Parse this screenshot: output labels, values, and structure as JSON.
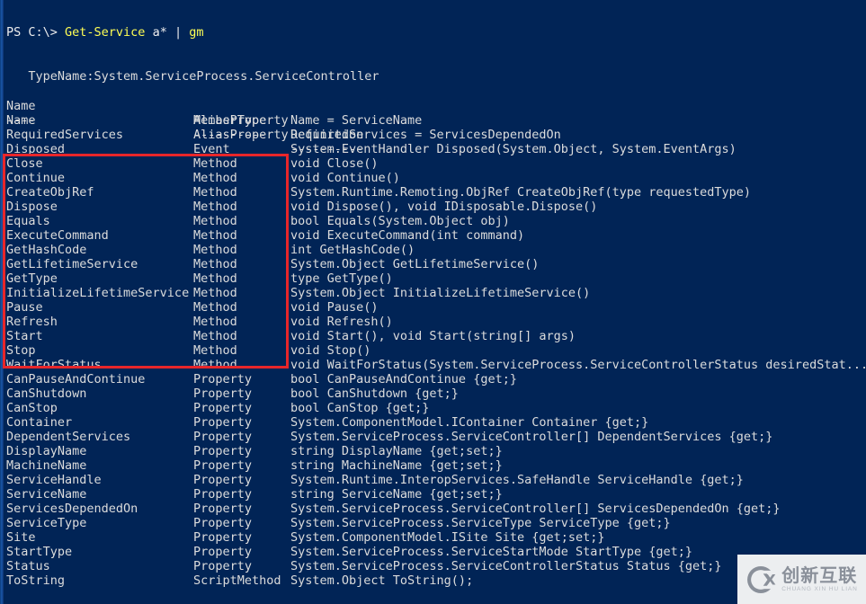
{
  "terminal": {
    "background_color": "#012456",
    "foreground_color": "#eeeeee",
    "accent_color": "#ffff54",
    "annotation_color": "#e8262a",
    "prompt": {
      "prefix": "PS C:\\> ",
      "command": "Get-Service",
      "argument": " a* ",
      "pipe": "| ",
      "cmdlet": "gm"
    },
    "typename_line": "   TypeName:System.ServiceProcess.ServiceController",
    "headers": {
      "name": "Name",
      "membertype": "MemberType",
      "definition": "Definition"
    },
    "separators": {
      "name": "----",
      "membertype": "----------",
      "definition": "----------"
    },
    "rows": [
      {
        "name": "Name",
        "membertype": "AliasProperty",
        "definition": "Name = ServiceName"
      },
      {
        "name": "RequiredServices",
        "membertype": "AliasProperty",
        "definition": "RequiredServices = ServicesDependedOn"
      },
      {
        "name": "Disposed",
        "membertype": "Event",
        "definition": "System.EventHandler Disposed(System.Object, System.EventArgs)"
      },
      {
        "name": "Close",
        "membertype": "Method",
        "definition": "void Close()"
      },
      {
        "name": "Continue",
        "membertype": "Method",
        "definition": "void Continue()"
      },
      {
        "name": "CreateObjRef",
        "membertype": "Method",
        "definition": "System.Runtime.Remoting.ObjRef CreateObjRef(type requestedType)"
      },
      {
        "name": "Dispose",
        "membertype": "Method",
        "definition": "void Dispose(), void IDisposable.Dispose()"
      },
      {
        "name": "Equals",
        "membertype": "Method",
        "definition": "bool Equals(System.Object obj)"
      },
      {
        "name": "ExecuteCommand",
        "membertype": "Method",
        "definition": "void ExecuteCommand(int command)"
      },
      {
        "name": "GetHashCode",
        "membertype": "Method",
        "definition": "int GetHashCode()"
      },
      {
        "name": "GetLifetimeService",
        "membertype": "Method",
        "definition": "System.Object GetLifetimeService()"
      },
      {
        "name": "GetType",
        "membertype": "Method",
        "definition": "type GetType()"
      },
      {
        "name": "InitializeLifetimeService",
        "membertype": "Method",
        "definition": "System.Object InitializeLifetimeService()"
      },
      {
        "name": "Pause",
        "membertype": "Method",
        "definition": "void Pause()"
      },
      {
        "name": "Refresh",
        "membertype": "Method",
        "definition": "void Refresh()"
      },
      {
        "name": "Start",
        "membertype": "Method",
        "definition": "void Start(), void Start(string[] args)"
      },
      {
        "name": "Stop",
        "membertype": "Method",
        "definition": "void Stop()"
      },
      {
        "name": "WaitForStatus",
        "membertype": "Method",
        "definition": "void WaitForStatus(System.ServiceProcess.ServiceControllerStatus desiredStat..."
      },
      {
        "name": "CanPauseAndContinue",
        "membertype": "Property",
        "definition": "bool CanPauseAndContinue {get;}"
      },
      {
        "name": "CanShutdown",
        "membertype": "Property",
        "definition": "bool CanShutdown {get;}"
      },
      {
        "name": "CanStop",
        "membertype": "Property",
        "definition": "bool CanStop {get;}"
      },
      {
        "name": "Container",
        "membertype": "Property",
        "definition": "System.ComponentModel.IContainer Container {get;}"
      },
      {
        "name": "DependentServices",
        "membertype": "Property",
        "definition": "System.ServiceProcess.ServiceController[] DependentServices {get;}"
      },
      {
        "name": "DisplayName",
        "membertype": "Property",
        "definition": "string DisplayName {get;set;}"
      },
      {
        "name": "MachineName",
        "membertype": "Property",
        "definition": "string MachineName {get;set;}"
      },
      {
        "name": "ServiceHandle",
        "membertype": "Property",
        "definition": "System.Runtime.InteropServices.SafeHandle ServiceHandle {get;}"
      },
      {
        "name": "ServiceName",
        "membertype": "Property",
        "definition": "string ServiceName {get;set;}"
      },
      {
        "name": "ServicesDependedOn",
        "membertype": "Property",
        "definition": "System.ServiceProcess.ServiceController[] ServicesDependedOn {get;}"
      },
      {
        "name": "ServiceType",
        "membertype": "Property",
        "definition": "System.ServiceProcess.ServiceType ServiceType {get;}"
      },
      {
        "name": "Site",
        "membertype": "Property",
        "definition": "System.ComponentModel.ISite Site {get;set;}"
      },
      {
        "name": "StartType",
        "membertype": "Property",
        "definition": "System.ServiceProcess.ServiceStartMode StartType {get;}"
      },
      {
        "name": "Status",
        "membertype": "Property",
        "definition": "System.ServiceProcess.ServiceControllerStatus Status {get;}"
      },
      {
        "name": "ToString",
        "membertype": "ScriptMethod",
        "definition": "System.Object ToString();"
      }
    ],
    "annotation": {
      "label": "method-rows-highlight",
      "first_row": "Close",
      "last_row": "WaitForStatus"
    },
    "watermark": {
      "logo_letters": "CX",
      "chinese": "创新互联",
      "pinyin": "CHUANG XIN HU LIAN"
    }
  }
}
